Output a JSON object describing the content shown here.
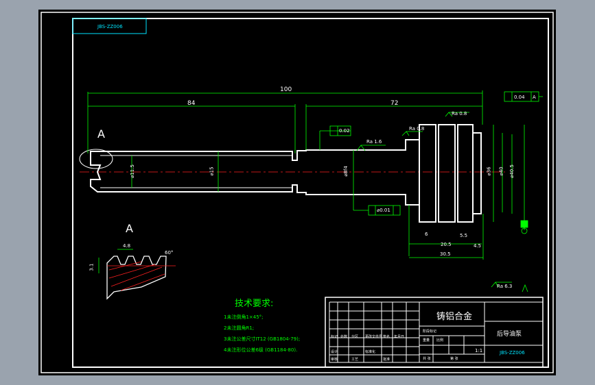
{
  "drawing_code": "JBS-ZZ006",
  "section_label": "A",
  "detail_label": "A",
  "dimensions": {
    "overall_length": "100",
    "left_length": "84",
    "right_length": "72",
    "bore_dia": "⌀11.5",
    "shaft_dia": "⌀15",
    "hub_dia": "⌀8f4",
    "seat_dia": "⌀36",
    "outer_dia": "⌀40",
    "outer_dia2": "⌀40.5",
    "gap1": "6",
    "gap2": "20.5",
    "gap3": "5.5",
    "end_w": "4.5",
    "total_w": "30.5",
    "detail_pitch": "4.8",
    "detail_height": "3.1",
    "detail_angle": "60°"
  },
  "tolerances": {
    "runout_top": "0.04",
    "position_mid": "0.02",
    "perp_bottom": "⌀0.01",
    "datum": "A",
    "roughness_1": "Ra 1.6",
    "roughness_2": "Ra 0.8",
    "roughness_3": "Ra 0.8",
    "roughness_4": "Ra 0.8",
    "roughness_general": "Ra 6.3"
  },
  "requirements": {
    "title": "技术要求:",
    "lines": [
      "1未注倒角1×45°;",
      "2未注圆角R1;",
      "3未注公差尺寸IT12 (GB1804-79);",
      "4未注形位公差6级 (GB1184-80)."
    ]
  },
  "title_block": {
    "material": "铸铝合金",
    "part_name": "后导油泵",
    "code": "JBS-ZZ006",
    "scale": "1:1",
    "fields": [
      "标记",
      "处数",
      "分区",
      "更改文件号",
      "签名",
      "年月日",
      "设计",
      "标准化",
      "阶段标记",
      "重量",
      "比例",
      "审核",
      "工艺",
      "批准",
      "共 张",
      "第 张"
    ]
  },
  "colors": {
    "frame": "#ffffff",
    "dim": "#00ff00",
    "center": "#ff2020",
    "border": "#00e5ff",
    "bg": "#000000"
  }
}
